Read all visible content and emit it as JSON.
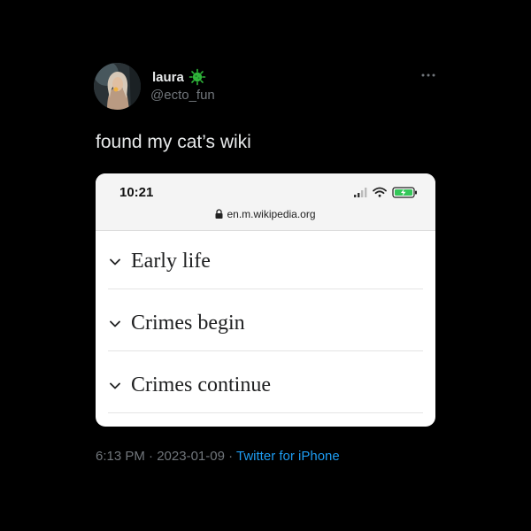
{
  "tweet": {
    "display_name": "laura",
    "handle": "@ecto_fun",
    "text": "found my cat’s wiki",
    "time": "6:13 PM",
    "date": "2023-01-09",
    "separator": " · ",
    "source": "Twitter for iPhone"
  },
  "media": {
    "status_time": "10:21",
    "url": "en.m.wikipedia.org",
    "sections": [
      {
        "label": "Early life"
      },
      {
        "label": "Crimes begin"
      },
      {
        "label": "Crimes continue"
      }
    ]
  },
  "icons": {
    "avatar": "avatar-photo",
    "badge": "green-virus-badge-icon",
    "more": "more-dots-icon",
    "signal": "signal-icon",
    "wifi": "wifi-icon",
    "battery": "battery-charging-icon",
    "lock": "lock-icon",
    "chevron": "chevron-down-icon"
  },
  "colors": {
    "background": "#000000",
    "text_primary": "#e7e9ea",
    "text_secondary": "#71767b",
    "link": "#1d9bf0",
    "badge": "#2fb43a",
    "battery": "#34c759"
  }
}
